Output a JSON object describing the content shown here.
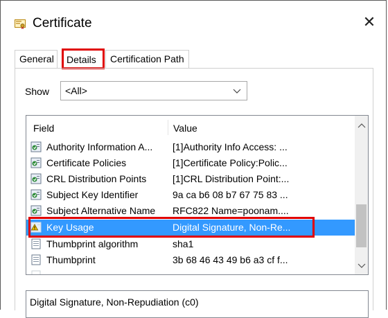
{
  "window": {
    "title": "Certificate"
  },
  "tabs": [
    {
      "label": "General"
    },
    {
      "label": "Details"
    },
    {
      "label": "Certification Path"
    }
  ],
  "show": {
    "label": "Show",
    "selected": "<All>"
  },
  "list": {
    "headers": {
      "field": "Field",
      "value": "Value"
    },
    "rows": [
      {
        "field": "Authority Information A...",
        "value": "[1]Authority Info Access: ...",
        "icon": "certificate-extension-icon"
      },
      {
        "field": "Certificate Policies",
        "value": "[1]Certificate Policy:Polic...",
        "icon": "certificate-extension-icon"
      },
      {
        "field": "CRL Distribution Points",
        "value": "[1]CRL Distribution Point:...",
        "icon": "certificate-extension-icon"
      },
      {
        "field": "Subject Key Identifier",
        "value": "9a ca b6 08 b7 67 75 83 ...",
        "icon": "certificate-extension-icon"
      },
      {
        "field": "Subject Alternative Name",
        "value": "RFC822 Name=poonam....",
        "icon": "certificate-extension-icon"
      },
      {
        "field": "Key Usage",
        "value": "Digital Signature, Non-Re...",
        "icon": "certificate-extension-warning-icon",
        "selected": true
      },
      {
        "field": "Thumbprint algorithm",
        "value": "sha1",
        "icon": "document-icon"
      },
      {
        "field": "Thumbprint",
        "value": "3b 68 46 43 49 b6 a3 cf f...",
        "icon": "document-icon"
      }
    ]
  },
  "detail": {
    "text": "Digital Signature, Non-Repudiation (c0)"
  },
  "colors": {
    "selection": "#3399ff",
    "highlight_outline": "#e00000"
  }
}
